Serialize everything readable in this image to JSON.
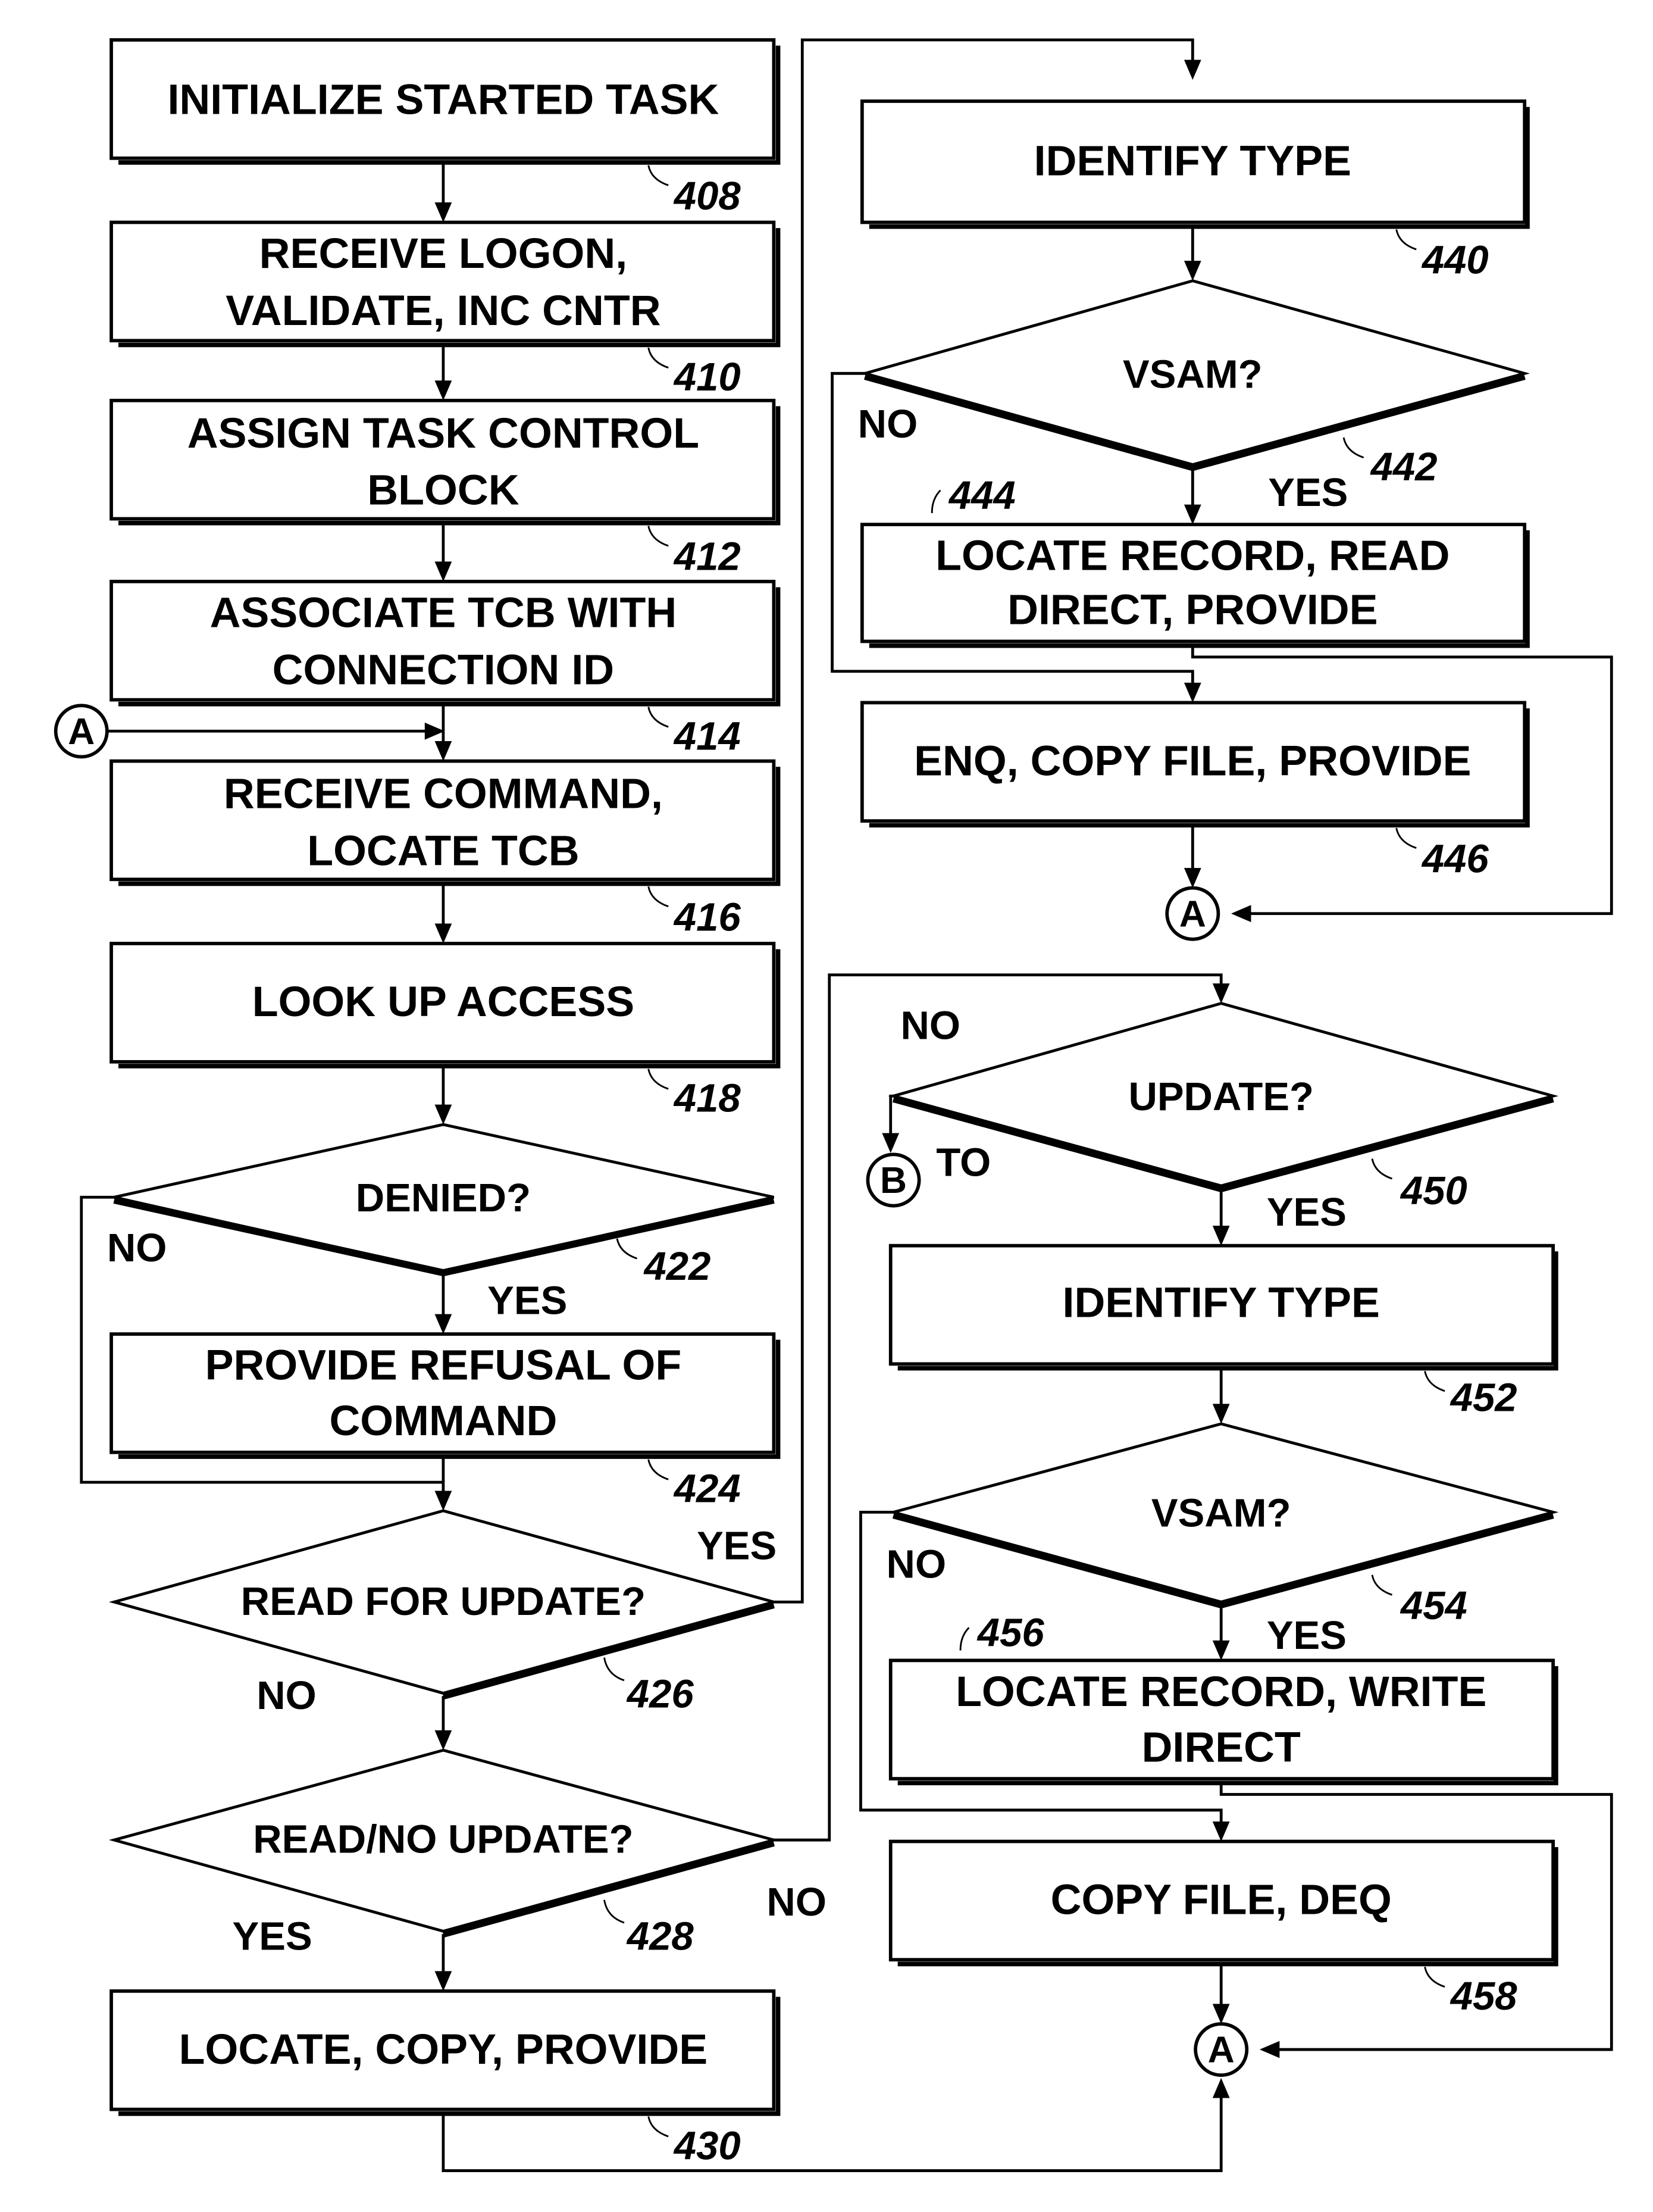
{
  "figure": {
    "left_column": {
      "steps": [
        {
          "id": "408",
          "lines": [
            "INITIALIZE STARTED TASK"
          ]
        },
        {
          "id": "410",
          "lines": [
            "RECEIVE LOGON,",
            "VALIDATE, INC CNTR"
          ]
        },
        {
          "id": "412",
          "lines": [
            "ASSIGN TASK CONTROL",
            "BLOCK"
          ]
        },
        {
          "id": "414",
          "lines": [
            "ASSOCIATE TCB WITH",
            "CONNECTION ID"
          ]
        },
        {
          "id": "416",
          "lines": [
            "RECEIVE COMMAND,",
            "LOCATE TCB"
          ]
        },
        {
          "id": "418",
          "lines": [
            "LOOK UP ACCESS"
          ]
        },
        {
          "id": "424",
          "lines": [
            "PROVIDE REFUSAL OF",
            "COMMAND"
          ]
        },
        {
          "id": "430",
          "lines": [
            "LOCATE, COPY, PROVIDE"
          ]
        }
      ],
      "decisions": [
        {
          "id": "422",
          "text": "DENIED?",
          "yes": "YES",
          "no": "NO"
        },
        {
          "id": "426",
          "text": "READ FOR UPDATE?",
          "yes": "YES",
          "no": "NO"
        },
        {
          "id": "428",
          "text": "READ/NO UPDATE?",
          "yes": "YES",
          "no": "NO"
        }
      ]
    },
    "right_top": {
      "steps": [
        {
          "id": "440",
          "lines": [
            "IDENTIFY TYPE"
          ]
        },
        {
          "id": "444",
          "lines": [
            "LOCATE RECORD, READ",
            "DIRECT, PROVIDE"
          ]
        },
        {
          "id": "446",
          "lines": [
            "ENQ, COPY FILE, PROVIDE"
          ]
        }
      ],
      "decisions": [
        {
          "id": "442",
          "text": "VSAM?",
          "yes": "YES",
          "no": "NO"
        }
      ]
    },
    "right_bottom": {
      "steps": [
        {
          "id": "452",
          "lines": [
            "IDENTIFY TYPE"
          ]
        },
        {
          "id": "456",
          "lines": [
            "LOCATE RECORD, WRITE",
            "DIRECT"
          ]
        },
        {
          "id": "458",
          "lines": [
            "COPY FILE, DEQ"
          ]
        }
      ],
      "decisions": [
        {
          "id": "450",
          "text": "UPDATE?",
          "yes": "YES",
          "no": "NO",
          "to_label": "TO"
        },
        {
          "id": "454",
          "text": "VSAM?",
          "yes": "YES",
          "no": "NO"
        }
      ]
    },
    "connectors": {
      "a": "A",
      "b": "B"
    }
  }
}
